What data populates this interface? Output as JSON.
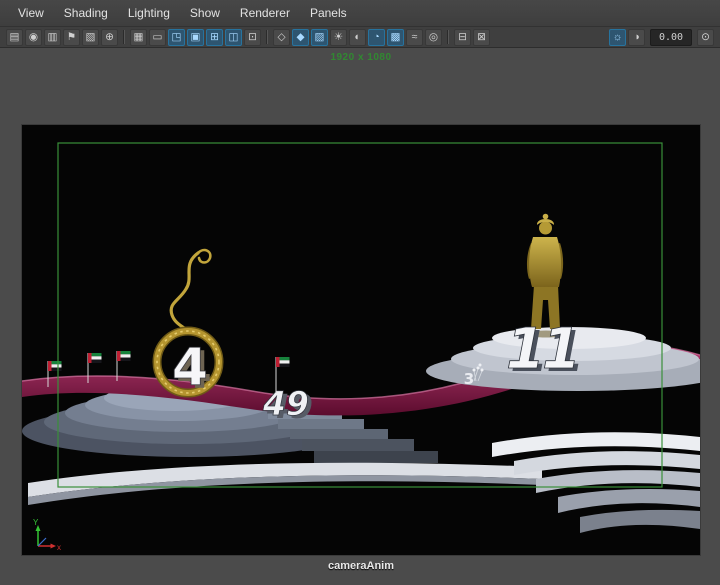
{
  "menu_bar": {
    "items": [
      {
        "label": "View"
      },
      {
        "label": "Shading"
      },
      {
        "label": "Lighting"
      },
      {
        "label": "Show"
      },
      {
        "label": "Renderer"
      },
      {
        "label": "Panels"
      }
    ]
  },
  "toolbar": {
    "exposure_value": "0.00",
    "icons": [
      {
        "name": "camera-select-icon",
        "glyph": "▤",
        "active": false
      },
      {
        "name": "camera-lock-icon",
        "glyph": "◉",
        "active": false
      },
      {
        "name": "camera-attributes-icon",
        "glyph": "▥",
        "active": false
      },
      {
        "name": "bookmark-icon",
        "glyph": "⚑",
        "active": false
      },
      {
        "name": "image-plane-icon",
        "glyph": "▧",
        "active": false
      },
      {
        "name": "pan-zoom-icon",
        "glyph": "⊕",
        "active": false
      },
      {
        "name": "grid-icon",
        "glyph": "▦",
        "active": false
      },
      {
        "name": "film-gate-icon",
        "glyph": "▭",
        "active": false
      },
      {
        "name": "resolution-gate-icon",
        "glyph": "◳",
        "active": true
      },
      {
        "name": "gate-mask-icon",
        "glyph": "▣",
        "active": true
      },
      {
        "name": "field-chart-icon",
        "glyph": "⊞",
        "active": true
      },
      {
        "name": "safe-action-icon",
        "glyph": "◫",
        "active": true
      },
      {
        "name": "safe-title-icon",
        "glyph": "⊡",
        "active": false
      },
      {
        "name": "wireframe-icon",
        "glyph": "◇",
        "active": false
      },
      {
        "name": "smooth-shade-icon",
        "glyph": "◆",
        "active": true
      },
      {
        "name": "textured-icon",
        "glyph": "▨",
        "active": true
      },
      {
        "name": "lights-icon",
        "glyph": "☀",
        "active": false
      },
      {
        "name": "shadows-icon",
        "glyph": "◐",
        "active": false
      },
      {
        "name": "ambient-occlusion-icon",
        "glyph": "◔",
        "active": true
      },
      {
        "name": "anti-alias-icon",
        "glyph": "▩",
        "active": true
      },
      {
        "name": "motion-blur-icon",
        "glyph": "≈",
        "active": false
      },
      {
        "name": "depth-of-field-icon",
        "glyph": "◎",
        "active": false
      },
      {
        "name": "isolate-select-icon",
        "glyph": "⊟",
        "active": false
      },
      {
        "name": "xray-icon",
        "glyph": "⊠",
        "active": false
      },
      {
        "name": "exposure-icon",
        "glyph": "☼",
        "active": true
      },
      {
        "name": "contrast-icon",
        "glyph": "◑",
        "active": false
      },
      {
        "name": "gamma-icon",
        "glyph": "⊙",
        "active": false
      }
    ]
  },
  "viewport": {
    "resolution_label": "1920 x 1080",
    "camera_label": "cameraAnim",
    "axis": {
      "y": "Y",
      "x": "x"
    },
    "scene": {
      "ring_number": "4",
      "mid_number": "49",
      "podium_number": "11",
      "small_number": "3"
    },
    "colors": {
      "gate_green": "#3a8f3a",
      "ribbon_magenta": "#7d1343",
      "gold": "#b5952f",
      "platform_left_blue": "#747e90",
      "platform_right_white": "#d6dae2",
      "background": "#050505"
    }
  }
}
